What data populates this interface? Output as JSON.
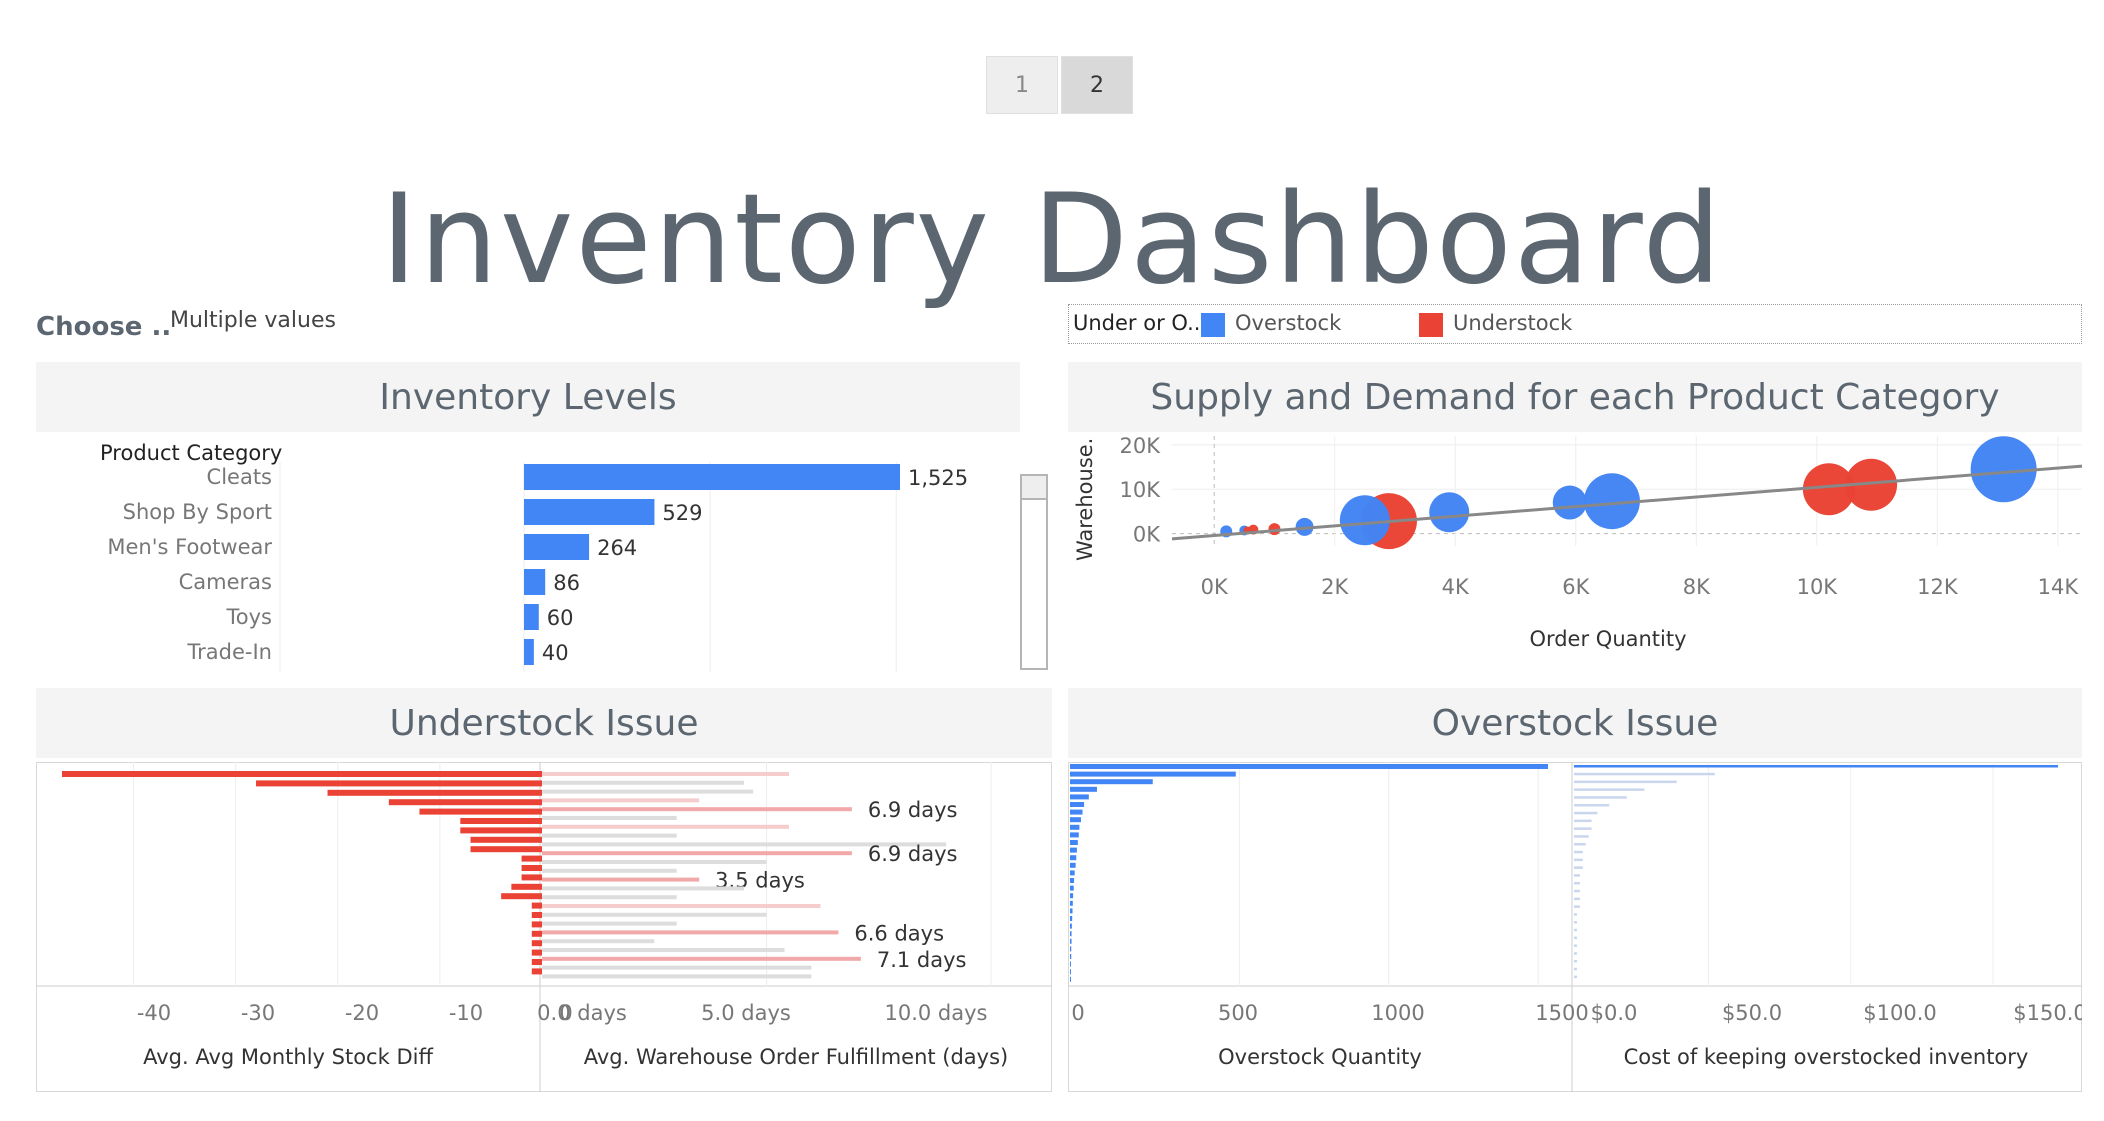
{
  "pager": {
    "pages": [
      "1",
      "2"
    ],
    "active": "2"
  },
  "title": "Inventory Dashboard",
  "filter": {
    "label": "Choose ..",
    "value": "Multiple values"
  },
  "legend": {
    "label": "Under or O..",
    "items": [
      {
        "name": "Overstock",
        "color": "#4285f4"
      },
      {
        "name": "Understock",
        "color": "#ea4335"
      }
    ]
  },
  "colors": {
    "overstock": "#4285f4",
    "understock": "#ea4335",
    "pink": "#f0a8a8",
    "lightgray": "#dddddd"
  },
  "panels": {
    "inventory_levels": "Inventory Levels",
    "supply_demand": "Supply and Demand for each Product Category",
    "understock": "Understock Issue",
    "overstock": "Overstock Issue"
  },
  "chart_data": [
    {
      "id": "inventory_levels",
      "type": "bar",
      "header": "Product Category",
      "categories": [
        "Cleats",
        "Shop By Sport",
        "Men's Footwear",
        "Cameras",
        "Toys",
        "Trade-In"
      ],
      "values": [
        1525,
        529,
        264,
        86,
        60,
        40
      ],
      "value_labels": [
        "1,525",
        "529",
        "264",
        "86",
        "60",
        "40"
      ],
      "xlim": [
        0,
        1525
      ]
    },
    {
      "id": "supply_demand",
      "type": "scatter",
      "xlabel": "Order Quantity",
      "ylabel": "Warehouse..",
      "x_ticks": [
        "0K",
        "2K",
        "4K",
        "6K",
        "8K",
        "10K",
        "12K",
        "14K"
      ],
      "y_ticks": [
        "0K",
        "10K",
        "20K"
      ],
      "xlim": [
        -700,
        14400
      ],
      "ylim": [
        -1000,
        22000
      ],
      "points": [
        {
          "x": 200,
          "y": 500,
          "size": 6,
          "group": "Overstock"
        },
        {
          "x": 500,
          "y": 700,
          "size": 5,
          "group": "Overstock"
        },
        {
          "x": 550,
          "y": 700,
          "size": 4,
          "group": "Understock"
        },
        {
          "x": 650,
          "y": 900,
          "size": 5,
          "group": "Understock"
        },
        {
          "x": 1000,
          "y": 1000,
          "size": 6,
          "group": "Understock"
        },
        {
          "x": 1500,
          "y": 1500,
          "size": 9,
          "group": "Overstock"
        },
        {
          "x": 2900,
          "y": 2800,
          "size": 28,
          "group": "Understock"
        },
        {
          "x": 2500,
          "y": 3000,
          "size": 25,
          "group": "Overstock"
        },
        {
          "x": 3900,
          "y": 4800,
          "size": 20,
          "group": "Overstock"
        },
        {
          "x": 5900,
          "y": 7000,
          "size": 17,
          "group": "Overstock"
        },
        {
          "x": 6600,
          "y": 7300,
          "size": 28,
          "group": "Overstock"
        },
        {
          "x": 10200,
          "y": 10000,
          "size": 26,
          "group": "Understock"
        },
        {
          "x": 10900,
          "y": 11000,
          "size": 26,
          "group": "Understock"
        },
        {
          "x": 13100,
          "y": 14500,
          "size": 33,
          "group": "Overstock"
        }
      ],
      "trend": {
        "x": [
          -700,
          14400
        ],
        "y": [
          -1200,
          15200
        ]
      }
    },
    {
      "id": "understock_diff",
      "type": "bar",
      "xlabel": "Avg. Avg Monthly Stock Diff",
      "x_ticks": [
        "-40",
        "-30",
        "-20",
        "-10",
        "0"
      ],
      "xlim": [
        -47,
        0
      ],
      "values": [
        -47,
        -28,
        -21,
        -15,
        -12,
        -8,
        -8,
        -7,
        -7,
        -2,
        -2,
        -2,
        -3,
        -4,
        -1,
        -1,
        -1,
        -1,
        -1,
        -1,
        -1,
        -1
      ]
    },
    {
      "id": "understock_days",
      "type": "bar",
      "xlabel": "Avg. Warehouse Order Fulfillment (days)",
      "x_ticks": [
        "0.0 days",
        "5.0 days",
        "10.0 days"
      ],
      "xlim": [
        0,
        11
      ],
      "values": [
        5.5,
        4.5,
        4.7,
        3.5,
        6.9,
        3.0,
        5.5,
        3.0,
        9.0,
        6.9,
        5.0,
        3.0,
        3.5,
        4.5,
        3.0,
        6.2,
        5.0,
        3.0,
        6.6,
        2.5,
        5.4,
        7.1,
        6.0,
        6.0
      ],
      "highlight_labels": [
        {
          "index": 4,
          "label": "6.9 days"
        },
        {
          "index": 9,
          "label": "6.9 days"
        },
        {
          "index": 12,
          "label": "3.5 days"
        },
        {
          "index": 18,
          "label": "6.6 days"
        },
        {
          "index": 21,
          "label": "7.1 days"
        }
      ]
    },
    {
      "id": "overstock_qty",
      "type": "bar",
      "xlabel": "Overstock Quantity",
      "x_ticks": [
        "0",
        "500",
        "1000",
        "1500"
      ],
      "xlim": [
        0,
        1600
      ],
      "values": [
        1525,
        529,
        264,
        86,
        60,
        45,
        40,
        35,
        30,
        28,
        25,
        22,
        20,
        18,
        15,
        13,
        12,
        10,
        9,
        8,
        7,
        6,
        5,
        5,
        4,
        4,
        3,
        3,
        2
      ]
    },
    {
      "id": "overstock_cost",
      "type": "bar",
      "xlabel": "Cost of keeping overstocked inventory",
      "x_ticks": [
        "$0.0",
        "$50.0",
        "$100.0",
        "$150.0"
      ],
      "xlim": [
        0,
        170
      ],
      "values": [
        165,
        48,
        35,
        24,
        18,
        12,
        8,
        6,
        6,
        5,
        4,
        3,
        3,
        3,
        2,
        2,
        2,
        2,
        2,
        1,
        1,
        1,
        1,
        1,
        1,
        1,
        1,
        1
      ]
    }
  ]
}
